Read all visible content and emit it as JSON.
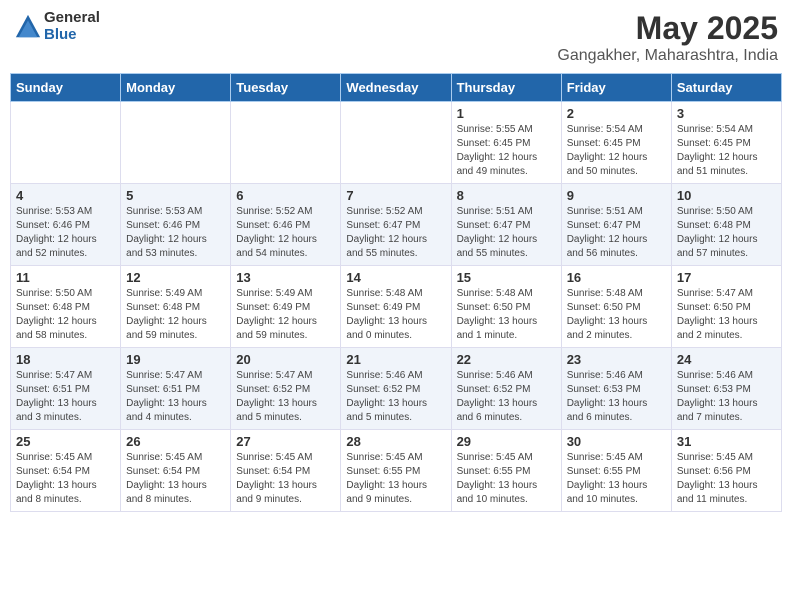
{
  "logo": {
    "general": "General",
    "blue": "Blue"
  },
  "title": "May 2025",
  "subtitle": "Gangakher, Maharashtra, India",
  "days_header": [
    "Sunday",
    "Monday",
    "Tuesday",
    "Wednesday",
    "Thursday",
    "Friday",
    "Saturday"
  ],
  "weeks": [
    [
      {
        "num": "",
        "info": ""
      },
      {
        "num": "",
        "info": ""
      },
      {
        "num": "",
        "info": ""
      },
      {
        "num": "",
        "info": ""
      },
      {
        "num": "1",
        "info": "Sunrise: 5:55 AM\nSunset: 6:45 PM\nDaylight: 12 hours\nand 49 minutes."
      },
      {
        "num": "2",
        "info": "Sunrise: 5:54 AM\nSunset: 6:45 PM\nDaylight: 12 hours\nand 50 minutes."
      },
      {
        "num": "3",
        "info": "Sunrise: 5:54 AM\nSunset: 6:45 PM\nDaylight: 12 hours\nand 51 minutes."
      }
    ],
    [
      {
        "num": "4",
        "info": "Sunrise: 5:53 AM\nSunset: 6:46 PM\nDaylight: 12 hours\nand 52 minutes."
      },
      {
        "num": "5",
        "info": "Sunrise: 5:53 AM\nSunset: 6:46 PM\nDaylight: 12 hours\nand 53 minutes."
      },
      {
        "num": "6",
        "info": "Sunrise: 5:52 AM\nSunset: 6:46 PM\nDaylight: 12 hours\nand 54 minutes."
      },
      {
        "num": "7",
        "info": "Sunrise: 5:52 AM\nSunset: 6:47 PM\nDaylight: 12 hours\nand 55 minutes."
      },
      {
        "num": "8",
        "info": "Sunrise: 5:51 AM\nSunset: 6:47 PM\nDaylight: 12 hours\nand 55 minutes."
      },
      {
        "num": "9",
        "info": "Sunrise: 5:51 AM\nSunset: 6:47 PM\nDaylight: 12 hours\nand 56 minutes."
      },
      {
        "num": "10",
        "info": "Sunrise: 5:50 AM\nSunset: 6:48 PM\nDaylight: 12 hours\nand 57 minutes."
      }
    ],
    [
      {
        "num": "11",
        "info": "Sunrise: 5:50 AM\nSunset: 6:48 PM\nDaylight: 12 hours\nand 58 minutes."
      },
      {
        "num": "12",
        "info": "Sunrise: 5:49 AM\nSunset: 6:48 PM\nDaylight: 12 hours\nand 59 minutes."
      },
      {
        "num": "13",
        "info": "Sunrise: 5:49 AM\nSunset: 6:49 PM\nDaylight: 12 hours\nand 59 minutes."
      },
      {
        "num": "14",
        "info": "Sunrise: 5:48 AM\nSunset: 6:49 PM\nDaylight: 13 hours\nand 0 minutes."
      },
      {
        "num": "15",
        "info": "Sunrise: 5:48 AM\nSunset: 6:50 PM\nDaylight: 13 hours\nand 1 minute."
      },
      {
        "num": "16",
        "info": "Sunrise: 5:48 AM\nSunset: 6:50 PM\nDaylight: 13 hours\nand 2 minutes."
      },
      {
        "num": "17",
        "info": "Sunrise: 5:47 AM\nSunset: 6:50 PM\nDaylight: 13 hours\nand 2 minutes."
      }
    ],
    [
      {
        "num": "18",
        "info": "Sunrise: 5:47 AM\nSunset: 6:51 PM\nDaylight: 13 hours\nand 3 minutes."
      },
      {
        "num": "19",
        "info": "Sunrise: 5:47 AM\nSunset: 6:51 PM\nDaylight: 13 hours\nand 4 minutes."
      },
      {
        "num": "20",
        "info": "Sunrise: 5:47 AM\nSunset: 6:52 PM\nDaylight: 13 hours\nand 5 minutes."
      },
      {
        "num": "21",
        "info": "Sunrise: 5:46 AM\nSunset: 6:52 PM\nDaylight: 13 hours\nand 5 minutes."
      },
      {
        "num": "22",
        "info": "Sunrise: 5:46 AM\nSunset: 6:52 PM\nDaylight: 13 hours\nand 6 minutes."
      },
      {
        "num": "23",
        "info": "Sunrise: 5:46 AM\nSunset: 6:53 PM\nDaylight: 13 hours\nand 6 minutes."
      },
      {
        "num": "24",
        "info": "Sunrise: 5:46 AM\nSunset: 6:53 PM\nDaylight: 13 hours\nand 7 minutes."
      }
    ],
    [
      {
        "num": "25",
        "info": "Sunrise: 5:45 AM\nSunset: 6:54 PM\nDaylight: 13 hours\nand 8 minutes."
      },
      {
        "num": "26",
        "info": "Sunrise: 5:45 AM\nSunset: 6:54 PM\nDaylight: 13 hours\nand 8 minutes."
      },
      {
        "num": "27",
        "info": "Sunrise: 5:45 AM\nSunset: 6:54 PM\nDaylight: 13 hours\nand 9 minutes."
      },
      {
        "num": "28",
        "info": "Sunrise: 5:45 AM\nSunset: 6:55 PM\nDaylight: 13 hours\nand 9 minutes."
      },
      {
        "num": "29",
        "info": "Sunrise: 5:45 AM\nSunset: 6:55 PM\nDaylight: 13 hours\nand 10 minutes."
      },
      {
        "num": "30",
        "info": "Sunrise: 5:45 AM\nSunset: 6:55 PM\nDaylight: 13 hours\nand 10 minutes."
      },
      {
        "num": "31",
        "info": "Sunrise: 5:45 AM\nSunset: 6:56 PM\nDaylight: 13 hours\nand 11 minutes."
      }
    ]
  ]
}
